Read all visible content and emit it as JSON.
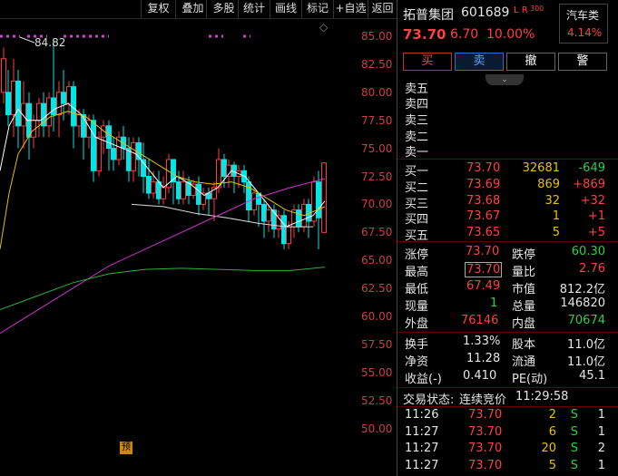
{
  "toolbar": {
    "buttons": [
      "复权",
      "叠加",
      "多股",
      "统计",
      "画线",
      "标记",
      "+自选",
      "返回"
    ]
  },
  "chart": {
    "y_axis_ticks": [
      "85.00",
      "82.50",
      "80.00",
      "77.50",
      "75.00",
      "72.50",
      "70.00",
      "67.50",
      "65.00",
      "62.50",
      "60.00",
      "57.50",
      "55.00",
      "52.50",
      "50.00"
    ],
    "high_marker": "84.82",
    "forecast_badge": "预"
  },
  "stock": {
    "name": "拓普集团",
    "code": "601689",
    "flags": "L R",
    "flag_num": "300",
    "sector": "汽车类",
    "sector_change": "4.14%",
    "price": "73.70",
    "change": "6.70",
    "change_pct": "10.00%"
  },
  "actions": [
    "买",
    "卖",
    "撤",
    "警"
  ],
  "sell_levels": [
    "卖五",
    "卖四",
    "卖三",
    "卖二",
    "卖一"
  ],
  "buy_levels": [
    {
      "label": "买一",
      "price": "73.70",
      "volume": "32681",
      "delta": "-649"
    },
    {
      "label": "买二",
      "price": "73.69",
      "volume": "869",
      "delta": "+869"
    },
    {
      "label": "买三",
      "price": "73.68",
      "volume": "32",
      "delta": "+32"
    },
    {
      "label": "买四",
      "price": "73.67",
      "volume": "1",
      "delta": "+1"
    },
    {
      "label": "买五",
      "price": "73.65",
      "volume": "5",
      "delta": "+5"
    }
  ],
  "quote": {
    "limit_up_label": "涨停",
    "limit_up": "73.70",
    "limit_down_label": "跌停",
    "limit_down": "60.30",
    "high_label": "最高",
    "high": "73.70",
    "vol_ratio_label": "量比",
    "vol_ratio": "2.76",
    "low_label": "最低",
    "low": "67.49",
    "mcap_label": "市值",
    "mcap": "812.2亿",
    "cur_vol_label": "现量",
    "cur_vol": "1",
    "total_vol_label": "总量",
    "total_vol": "146820",
    "outer_label": "外盘",
    "outer": "76146",
    "inner_label": "内盘",
    "inner": "70674",
    "turnover_label": "换手",
    "turnover": "1.33%",
    "capital_label": "股本",
    "capital": "11.0亿",
    "nav_label": "净资",
    "nav": "11.28",
    "float_label": "流通",
    "float": "11.0亿",
    "eps_label": "收益(-)",
    "eps": "0.410",
    "pe_label": "PE(动)",
    "pe": "45.1"
  },
  "status": {
    "label": "交易状态:",
    "value": "连续竞价",
    "time": "11:29:58"
  },
  "ticks": [
    {
      "time": "11:26",
      "price": "73.70",
      "vol": "2",
      "side": "S",
      "n": "1"
    },
    {
      "time": "11:27",
      "price": "73.70",
      "vol": "6",
      "side": "S",
      "n": "1"
    },
    {
      "time": "11:27",
      "price": "73.70",
      "vol": "20",
      "side": "S",
      "n": "2"
    },
    {
      "time": "11:27",
      "price": "73.70",
      "vol": "5",
      "side": "S",
      "n": "1"
    }
  ]
}
